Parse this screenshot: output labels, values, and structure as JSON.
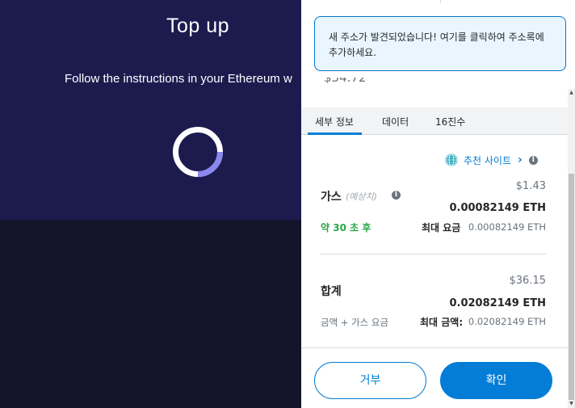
{
  "background_page": {
    "title": "Top up",
    "instructions": "Follow the instructions in your Ethereum w"
  },
  "popup": {
    "notice_text": "새 주소가 발견되었습니다! 여기를 클릭하여 주소록에 추가하세요.",
    "amount_peek": "$34.72",
    "tabs": [
      {
        "label": "세부 정보",
        "active": true
      },
      {
        "label": "데이터",
        "active": false
      },
      {
        "label": "16진수",
        "active": false
      }
    ],
    "recommended_site": "추천 사이트",
    "gas": {
      "label": "가스",
      "estimated": "(예상치)",
      "usd": "$1.43",
      "eth": "0.00082149 ETH",
      "time": "약 30 초 후",
      "max_fee_label": "최대 요금",
      "max_fee_value": "0.00082149 ETH"
    },
    "total": {
      "label": "합계",
      "usd": "$36.15",
      "eth": "0.02082149 ETH",
      "subtitle": "금액 + 가스 요금",
      "max_amount_label": "최대 금액:",
      "max_amount_value": "0.02082149 ETH"
    },
    "buttons": {
      "reject": "거부",
      "confirm": "확인"
    }
  },
  "colors": {
    "bg_top": "#1d1b4e",
    "bg_bottom": "#14152b",
    "accent": "#037dd6",
    "success": "#28a745",
    "notice_bg": "#eaf6ff"
  }
}
